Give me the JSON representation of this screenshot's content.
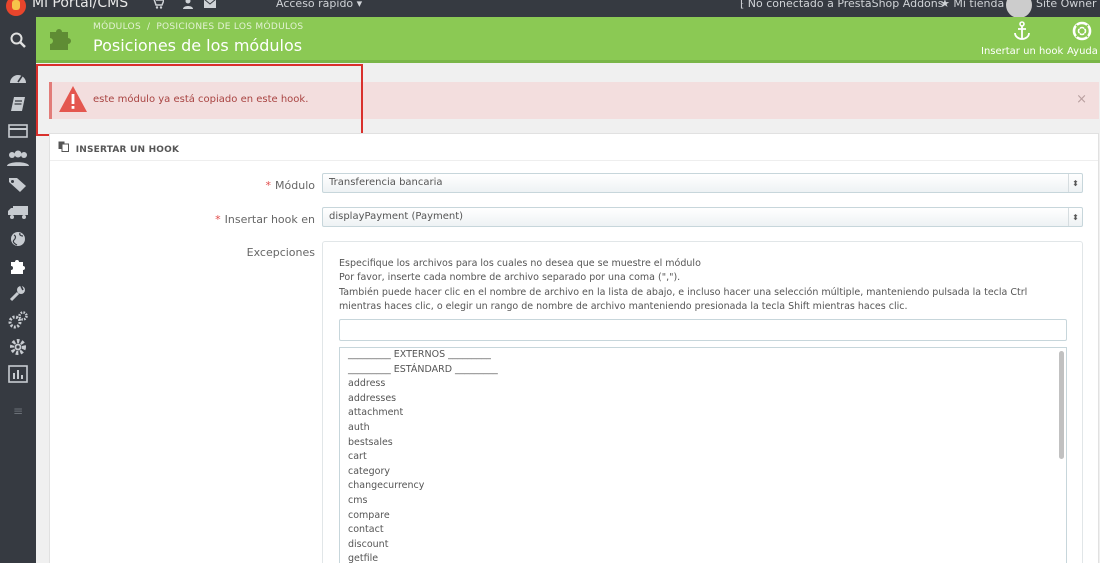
{
  "topbar": {
    "shop_name": "Mi Portal/CMS",
    "cart_icon": "cart-icon",
    "user_icon": "user-icon",
    "mail_icon": "envelope-icon",
    "quick_access": "Acceso rápido ▾",
    "addons_status": "No conectado a PrestaShop Addons",
    "my_store": "Mi tienda",
    "owner": "Site Owner ▾"
  },
  "sidebar": {
    "items": [
      "search-icon",
      "dashboard-icon",
      "orders-icon",
      "payment-icon",
      "customers-icon",
      "tags-icon",
      "shipping-icon",
      "globe-icon",
      "modules-icon",
      "wrench-icon",
      "gears-icon",
      "cog-icon",
      "stats-icon",
      "menu-icon"
    ]
  },
  "header": {
    "breadcrumb": [
      "MÓDULOS",
      "POSICIONES DE LOS MÓDULOS"
    ],
    "title": "Posiciones de los módulos",
    "insert_hook": "Insertar un hook",
    "help": "Ayuda"
  },
  "alert": {
    "message": "este módulo ya está copiado en este hook.",
    "close": "×"
  },
  "panel": {
    "heading": "INSERTAR UN HOOK",
    "module_label": "Módulo",
    "module_value": "Transferencia bancaria",
    "hook_label": "Insertar hook en",
    "hook_value": "displayPayment (Payment)",
    "exceptions_label": "Excepciones",
    "exceptions_help": [
      "Especifique los archivos para los cuales no desea que se muestre el módulo",
      "Por favor, inserte cada nombre de archivo separado por una coma (\",\").",
      "También puede hacer clic en el nombre de archivo en la lista de abajo, e incluso hacer una selección múltiple, manteniendo pulsada la tecla Ctrl mientras haces clic, o elegir un rango de nombre de archivo manteniendo presionada la tecla Shift mientras haces clic."
    ],
    "exceptions_input": "",
    "exceptions_list": [
      "_________ EXTERNOS _________",
      "_________ ESTÁNDARD _________",
      "address",
      "addresses",
      "attachment",
      "auth",
      "bestsales",
      "cart",
      "category",
      "changecurrency",
      "cms",
      "compare",
      "contact",
      "discount",
      "getfile"
    ]
  },
  "colors": {
    "topbar": "#363a41",
    "header_green": "#8bc954",
    "alert_bg": "#f3dede",
    "alert_text": "#a94442",
    "highlight_border": "#d9302c"
  }
}
